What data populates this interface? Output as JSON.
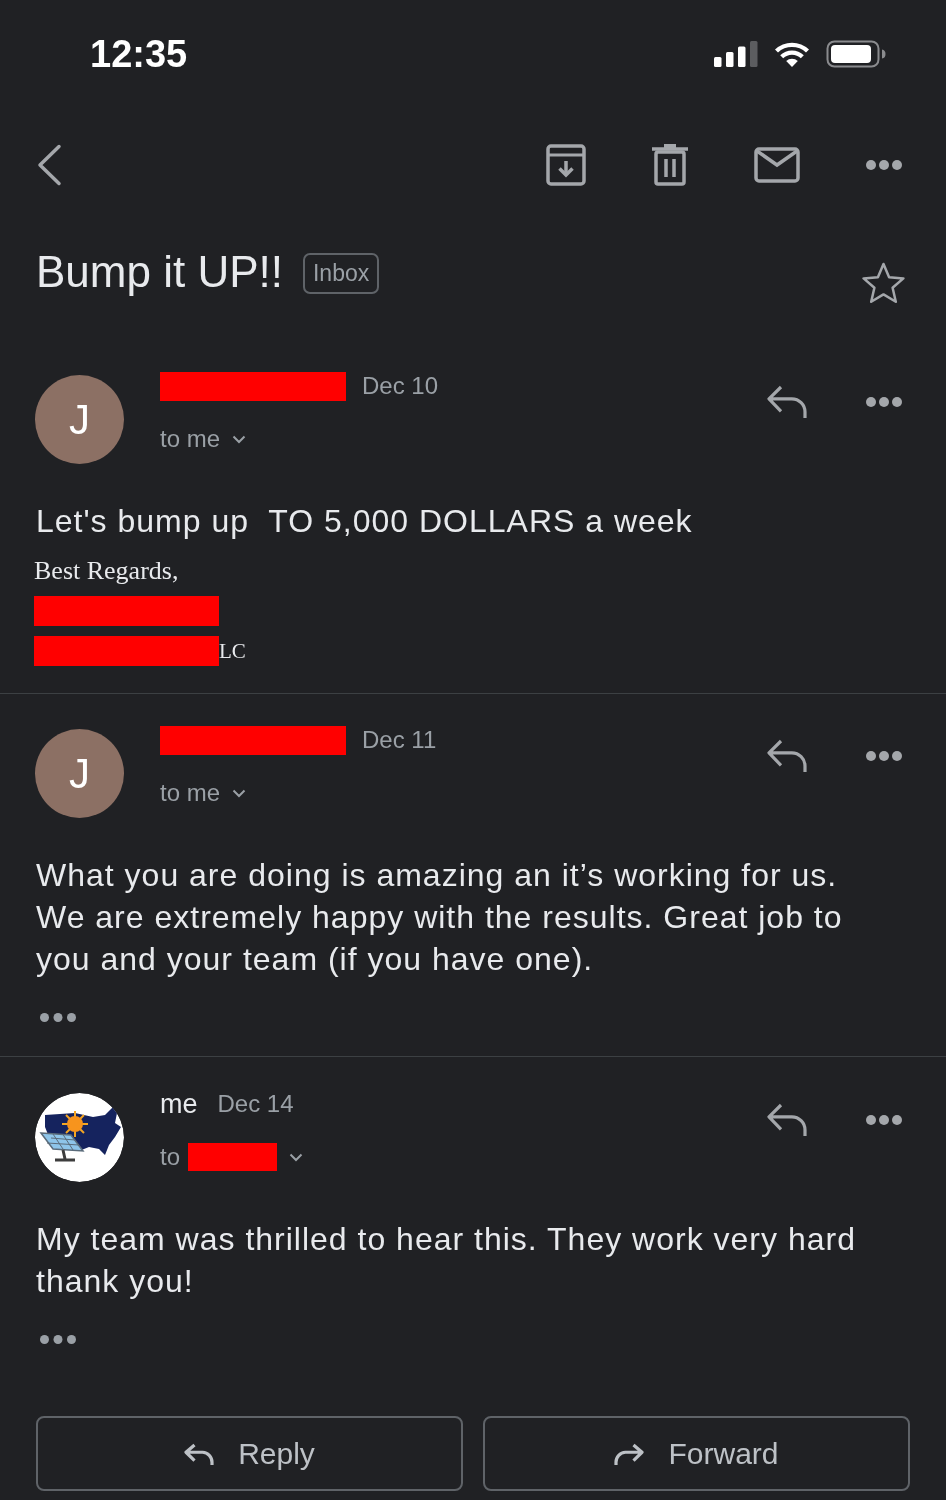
{
  "status_bar": {
    "time": "12:35"
  },
  "subject": {
    "title": "Bump it UP!!",
    "label": "Inbox",
    "starred": false
  },
  "messages": [
    {
      "avatar": {
        "kind": "letter",
        "letter": "J",
        "color": "#8c7064"
      },
      "sender": {
        "redacted": true
      },
      "date": "Dec 10",
      "recipient": {
        "text": "to me",
        "redacted": false
      },
      "body": "Let's bump up  TO 5,000 DOLLARS a week",
      "signature": [
        {
          "text": "Best Regards,",
          "redacted": false
        },
        {
          "redacted": true
        },
        {
          "text": "LC",
          "redacted": true
        }
      ],
      "trimmed_content": false
    },
    {
      "avatar": {
        "kind": "letter",
        "letter": "J",
        "color": "#8c7064"
      },
      "sender": {
        "redacted": true
      },
      "date": "Dec 11",
      "recipient": {
        "text": "to me",
        "redacted": false
      },
      "body": "What you are doing is amazing an it’s working for us. We are extremely happy with the results. Great job to you and your team (if you have one).",
      "trimmed_content": true
    },
    {
      "avatar": {
        "kind": "logo"
      },
      "sender": {
        "name": "me",
        "redacted": false
      },
      "date": "Dec 14",
      "recipient": {
        "text": "to",
        "redacted": true
      },
      "body": "My team was thrilled to hear this. They work very hard thank you!",
      "trimmed_content": true
    }
  ],
  "actions": [
    {
      "kind": "reply",
      "label": "Reply"
    },
    {
      "kind": "forward",
      "label": "Forward"
    }
  ]
}
